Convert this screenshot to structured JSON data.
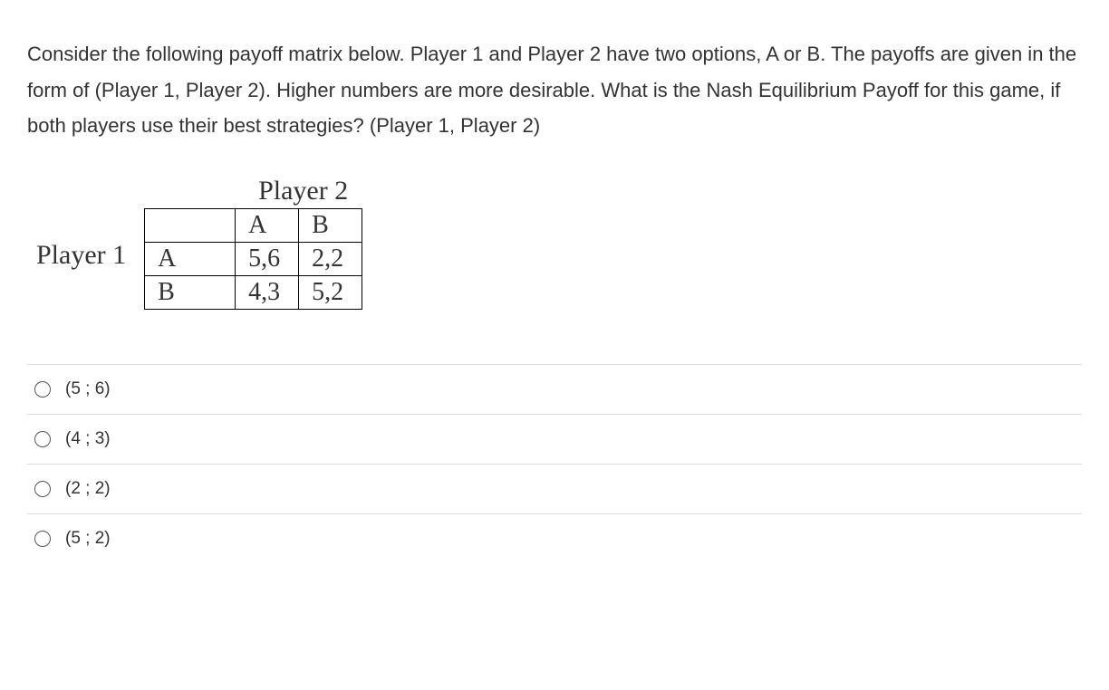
{
  "question": "Consider the following payoff matrix below. Player 1 and Player 2 have two options, A or B. The payoffs are given in the form of (Player 1, Player 2). Higher numbers are more desirable. What is the Nash Equilibrium Payoff for this game, if both players use their best strategies? (Player 1, Player 2)",
  "matrix": {
    "player1_label": "Player 1",
    "player2_label": "Player 2",
    "col_a": "A",
    "col_b": "B",
    "row_a": "A",
    "row_b": "B",
    "cell_aa": "5,6",
    "cell_ab": "2,2",
    "cell_ba": "4,3",
    "cell_bb": "5,2"
  },
  "options": [
    {
      "label": "(5 ; 6)"
    },
    {
      "label": "(4 ; 3)"
    },
    {
      "label": "(2 ; 2)"
    },
    {
      "label": "(5 ; 2)"
    }
  ]
}
